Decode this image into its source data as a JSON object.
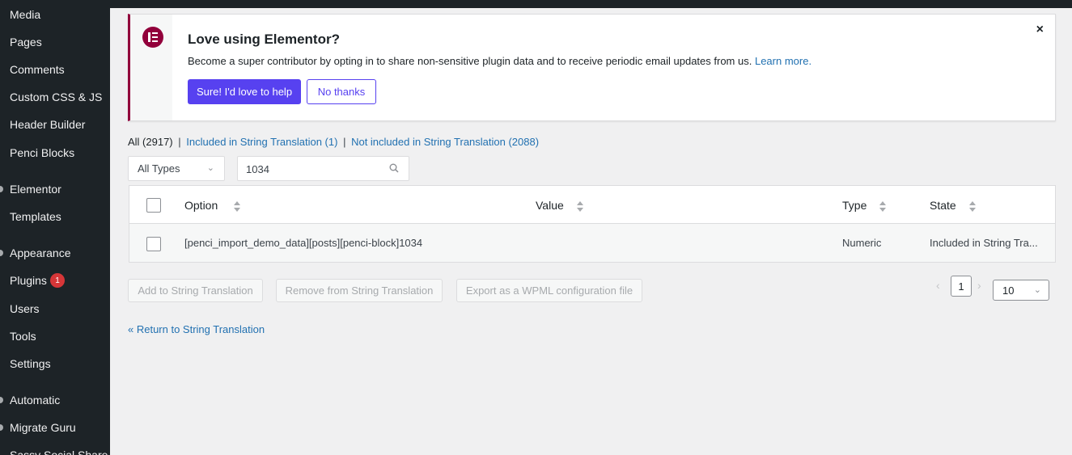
{
  "sidebar": {
    "items": [
      {
        "label": "Media"
      },
      {
        "label": "Pages"
      },
      {
        "label": "Comments"
      },
      {
        "label": "Custom CSS & JS"
      },
      {
        "label": "Header Builder"
      },
      {
        "label": "Penci Blocks"
      },
      {
        "label": "Elementor"
      },
      {
        "label": "Templates"
      },
      {
        "label": "Appearance"
      },
      {
        "label": "Plugins",
        "badge": "1"
      },
      {
        "label": "Users"
      },
      {
        "label": "Tools"
      },
      {
        "label": "Settings"
      },
      {
        "label": "Automatic"
      },
      {
        "label": "Migrate Guru"
      },
      {
        "label": "Sassy Social Share"
      }
    ]
  },
  "notice": {
    "title": "Love using Elementor?",
    "message": "Become a super contributor by opting in to share non-sensitive plugin data and to receive periodic email updates from us.",
    "learn_more": "Learn more.",
    "primary_button": "Sure! I'd love to help",
    "secondary_button": "No thanks",
    "close": "×"
  },
  "filters": {
    "all": "All (2917)",
    "included": "Included in String Translation (1)",
    "not_included": "Not included in String Translation (2088)",
    "separator": "|"
  },
  "type_select": {
    "value": "All Types"
  },
  "search": {
    "value": "1034"
  },
  "table": {
    "headers": {
      "option": "Option",
      "value": "Value",
      "type": "Type",
      "state": "State"
    },
    "rows": [
      {
        "option": "[penci_import_demo_data][posts][penci-block]1034",
        "value": "",
        "type": "Numeric",
        "state": "Included in String Tra..."
      }
    ]
  },
  "actions": {
    "add": "Add to String Translation",
    "remove": "Remove from String Translation",
    "export": "Export as a WPML configuration file"
  },
  "pagination": {
    "prev": "‹",
    "current": "1",
    "next": "›",
    "per_page": "10"
  },
  "return_link": "« Return to String Translation",
  "colors": {
    "accent": "#5741f0",
    "elementor": "#92003b",
    "link": "#2271b1",
    "admin_menu": "#1d2327"
  }
}
